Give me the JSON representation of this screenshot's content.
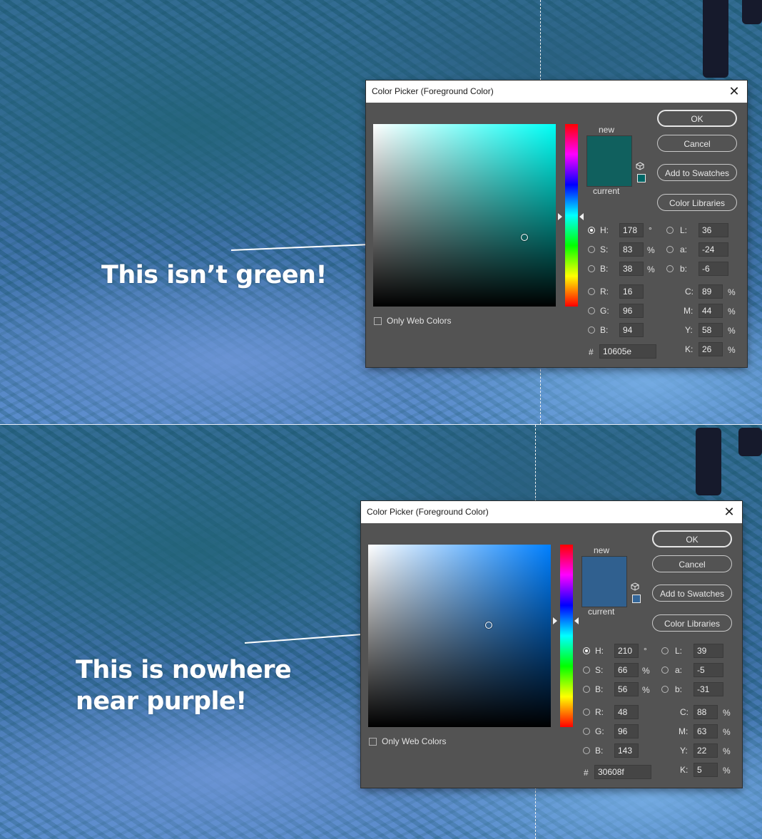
{
  "pickers": [
    {
      "title": "Color Picker (Foreground Color)",
      "close_glyph": "✕",
      "annotation": [
        "This isn’t green!",
        ""
      ],
      "hue_color": "#00fff6",
      "new_color": "#10605e",
      "web_safe_color": "#006666",
      "saturation": 0.83,
      "brightness": 0.38,
      "hue_fraction": 0.506,
      "labels": {
        "new": "new",
        "current": "current",
        "only_web": "Only Web Colors",
        "hash": "#"
      },
      "buttons": {
        "ok": "OK",
        "cancel": "Cancel",
        "add": "Add to Swatches",
        "libraries": "Color Libraries"
      },
      "fields": {
        "H": {
          "label": "H:",
          "value": "178",
          "unit": "°"
        },
        "S": {
          "label": "S:",
          "value": "83",
          "unit": "%"
        },
        "Bv": {
          "label": "B:",
          "value": "38",
          "unit": "%"
        },
        "R": {
          "label": "R:",
          "value": "16"
        },
        "G": {
          "label": "G:",
          "value": "96"
        },
        "Bl": {
          "label": "B:",
          "value": "94"
        },
        "L": {
          "label": "L:",
          "value": "36"
        },
        "a": {
          "label": "a:",
          "value": "-24"
        },
        "b": {
          "label": "b:",
          "value": "-6"
        },
        "C": {
          "label": "C:",
          "value": "89",
          "unit": "%"
        },
        "M": {
          "label": "M:",
          "value": "44",
          "unit": "%"
        },
        "Y": {
          "label": "Y:",
          "value": "58",
          "unit": "%"
        },
        "K": {
          "label": "K:",
          "value": "26",
          "unit": "%"
        },
        "hex": "10605e"
      }
    },
    {
      "title": "Color Picker (Foreground Color)",
      "close_glyph": "✕",
      "annotation": [
        "This is nowhere",
        "near purple!"
      ],
      "hue_color": "#0080ff",
      "new_color": "#30608f",
      "web_safe_color": "#336699",
      "saturation": 0.66,
      "brightness": 0.56,
      "hue_fraction": 0.417,
      "labels": {
        "new": "new",
        "current": "current",
        "only_web": "Only Web Colors",
        "hash": "#"
      },
      "buttons": {
        "ok": "OK",
        "cancel": "Cancel",
        "add": "Add to Swatches",
        "libraries": "Color Libraries"
      },
      "fields": {
        "H": {
          "label": "H:",
          "value": "210",
          "unit": "°"
        },
        "S": {
          "label": "S:",
          "value": "66",
          "unit": "%"
        },
        "Bv": {
          "label": "B:",
          "value": "56",
          "unit": "%"
        },
        "R": {
          "label": "R:",
          "value": "48"
        },
        "G": {
          "label": "G:",
          "value": "96"
        },
        "Bl": {
          "label": "B:",
          "value": "143"
        },
        "L": {
          "label": "L:",
          "value": "39"
        },
        "a": {
          "label": "a:",
          "value": "-5"
        },
        "b": {
          "label": "b:",
          "value": "-31"
        },
        "C": {
          "label": "C:",
          "value": "88",
          "unit": "%"
        },
        "M": {
          "label": "M:",
          "value": "63",
          "unit": "%"
        },
        "Y": {
          "label": "Y:",
          "value": "22",
          "unit": "%"
        },
        "K": {
          "label": "K:",
          "value": "5",
          "unit": "%"
        },
        "hex": "30608f"
      }
    }
  ]
}
